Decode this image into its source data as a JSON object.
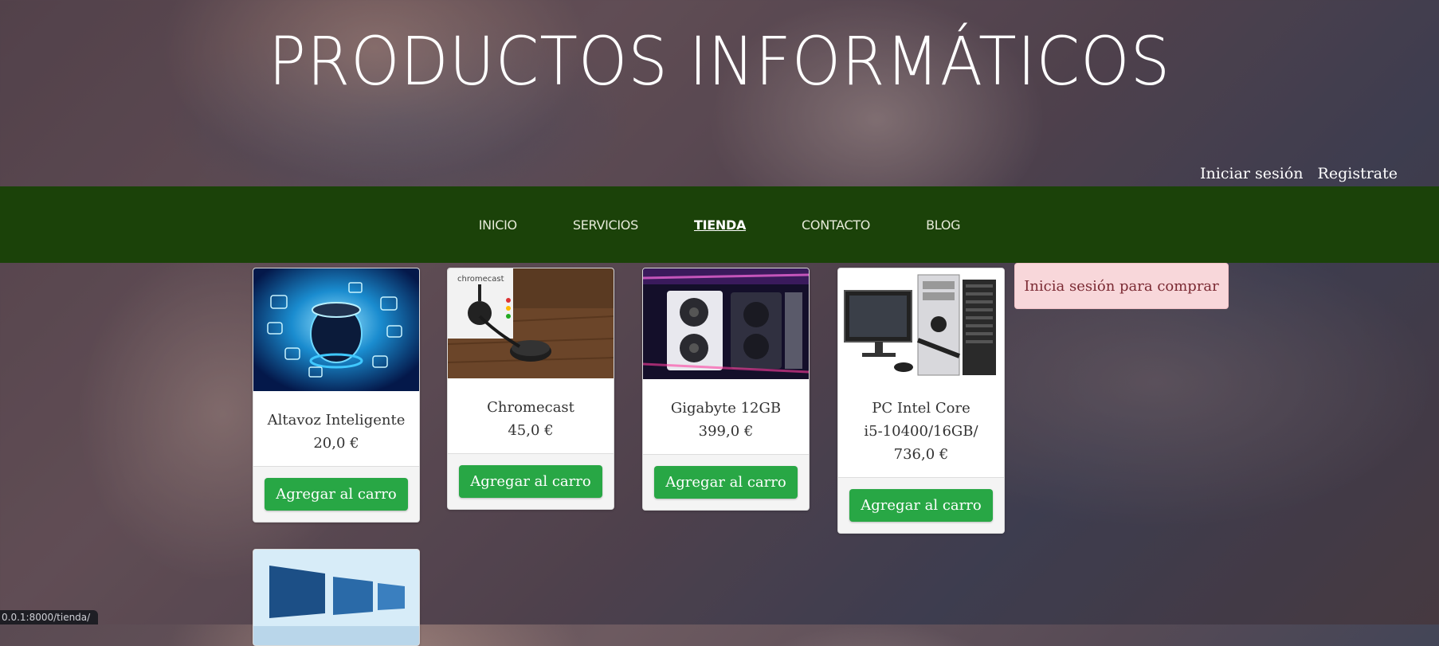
{
  "header": {
    "title": "PRODUCTOS INFORMÁTICOS",
    "login_label": "Iniciar sesión",
    "register_label": "Registrate"
  },
  "nav": {
    "items": [
      {
        "label": "INICIO"
      },
      {
        "label": "SERVICIOS"
      },
      {
        "label": "TIENDA"
      },
      {
        "label": "CONTACTO"
      },
      {
        "label": "BLOG"
      }
    ],
    "active_index": 2
  },
  "products": [
    {
      "name": "Altavoz Inteligente",
      "price": "20,0 €",
      "button": "Agregar al carro",
      "icon": "smart-speaker"
    },
    {
      "name": "Chromecast",
      "price": "45,0 €",
      "button": "Agregar al carro",
      "icon": "chromecast",
      "img_text": "chromecast"
    },
    {
      "name": "Gigabyte 12GB",
      "price": "399,0 €",
      "button": "Agregar al carro",
      "icon": "graphics-card"
    },
    {
      "name": "PC Intel Core i5-10400/16GB/",
      "price": "736,0 €",
      "button": "Agregar al carro",
      "icon": "desktop-pc"
    },
    {
      "name": "",
      "price": "",
      "button": "",
      "icon": "monitors"
    }
  ],
  "alert": {
    "text": "Inicia sesión para comprar"
  },
  "status_bar": {
    "text": "0.0.1:8000/tienda/"
  },
  "colors": {
    "nav_bg": "#1b4209",
    "button": "#28a745",
    "alert_bg": "#f8d7da"
  }
}
